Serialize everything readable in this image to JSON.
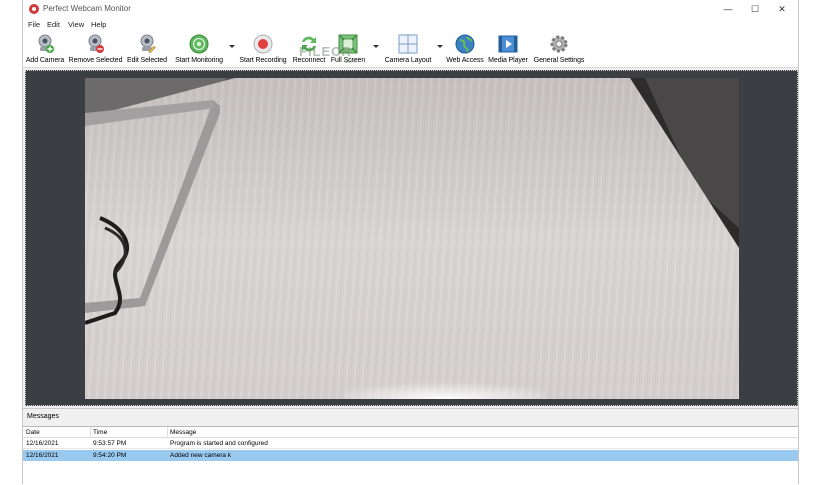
{
  "window": {
    "title": "Perfect Webcam Monitor",
    "controls": [
      "—",
      "☐",
      "✕"
    ]
  },
  "menu": [
    "File",
    "Edit",
    "View",
    "Help"
  ],
  "toolbar": {
    "add_camera": "Add Camera",
    "remove_selected": "Remove Selected",
    "edit_selected": "Edit Selected",
    "start_monitoring": "Start Monitoring",
    "start_recording": "Start Recording",
    "reconnect": "Reconnect",
    "full_screen": "Full Screen",
    "camera_layout": "Camera Layout",
    "web_access": "Web Access",
    "media_player": "Media Player",
    "general_settings": "General Settings"
  },
  "watermark": {
    "line1": "FILECR",
    "line2": ".com"
  },
  "messages": {
    "title": "Messages",
    "columns": [
      "Date",
      "Time",
      "Message"
    ],
    "rows": [
      {
        "date": "12/16/2021",
        "time": "9:53:57 PM",
        "message": "Program is started and configured"
      },
      {
        "date": "12/16/2021",
        "time": "9:54:20 PM",
        "message": "Added new camera k"
      }
    ],
    "selected_row": 1
  },
  "colors": {
    "video_background": "#3b3e43",
    "selected_row": "#99c9ef",
    "record_red": "#e04040",
    "monitor_green": "#4aa84a"
  }
}
